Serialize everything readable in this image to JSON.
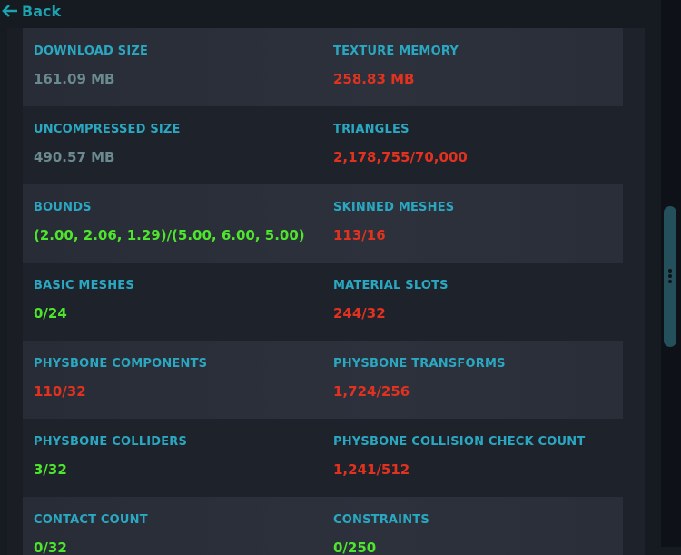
{
  "back_label": "Back",
  "colors": {
    "label": "#2aa8c2",
    "neutral": "#6b8a90",
    "bad": "#e2321f",
    "good": "#4ee62c"
  },
  "stats": [
    {
      "left": {
        "label": "DOWNLOAD SIZE",
        "value": "161.09 MB",
        "status": "neutral"
      },
      "right": {
        "label": "TEXTURE MEMORY",
        "value": "258.83 MB",
        "status": "bad"
      }
    },
    {
      "left": {
        "label": "UNCOMPRESSED SIZE",
        "value": "490.57 MB",
        "status": "neutral"
      },
      "right": {
        "label": "TRIANGLES",
        "value": "2,178,755/70,000",
        "status": "bad"
      }
    },
    {
      "left": {
        "label": "BOUNDS",
        "value": "(2.00, 2.06, 1.29)/(5.00, 6.00, 5.00)",
        "status": "good"
      },
      "right": {
        "label": "SKINNED MESHES",
        "value": "113/16",
        "status": "bad"
      }
    },
    {
      "left": {
        "label": "BASIC MESHES",
        "value": "0/24",
        "status": "good"
      },
      "right": {
        "label": "MATERIAL SLOTS",
        "value": "244/32",
        "status": "bad"
      }
    },
    {
      "left": {
        "label": "PHYSBONE COMPONENTS",
        "value": "110/32",
        "status": "bad"
      },
      "right": {
        "label": "PHYSBONE TRANSFORMS",
        "value": "1,724/256",
        "status": "bad"
      }
    },
    {
      "left": {
        "label": "PHYSBONE COLLIDERS",
        "value": "3/32",
        "status": "good"
      },
      "right": {
        "label": "PHYSBONE COLLISION CHECK COUNT",
        "value": "1,241/512",
        "status": "bad"
      }
    },
    {
      "left": {
        "label": "CONTACT COUNT",
        "value": "0/32",
        "status": "good"
      },
      "right": {
        "label": "CONSTRAINTS",
        "value": "0/250",
        "status": "good"
      }
    }
  ]
}
